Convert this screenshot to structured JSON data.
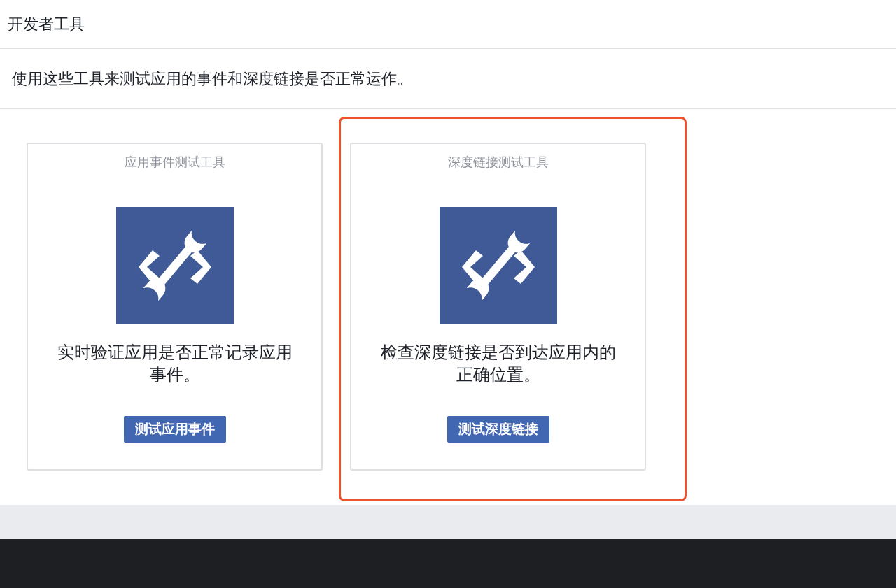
{
  "header": {
    "title": "开发者工具"
  },
  "description": "使用这些工具来测试应用的事件和深度链接是否正常运作。",
  "tools": [
    {
      "title": "应用事件测试工具",
      "text": "实时验证应用是否正常记录应用事件。",
      "button": "测试应用事件",
      "highlighted": false
    },
    {
      "title": "深度链接测试工具",
      "text": "检查深度链接是否到达应用内的正确位置。",
      "button": "测试深度链接",
      "highlighted": true
    }
  ]
}
